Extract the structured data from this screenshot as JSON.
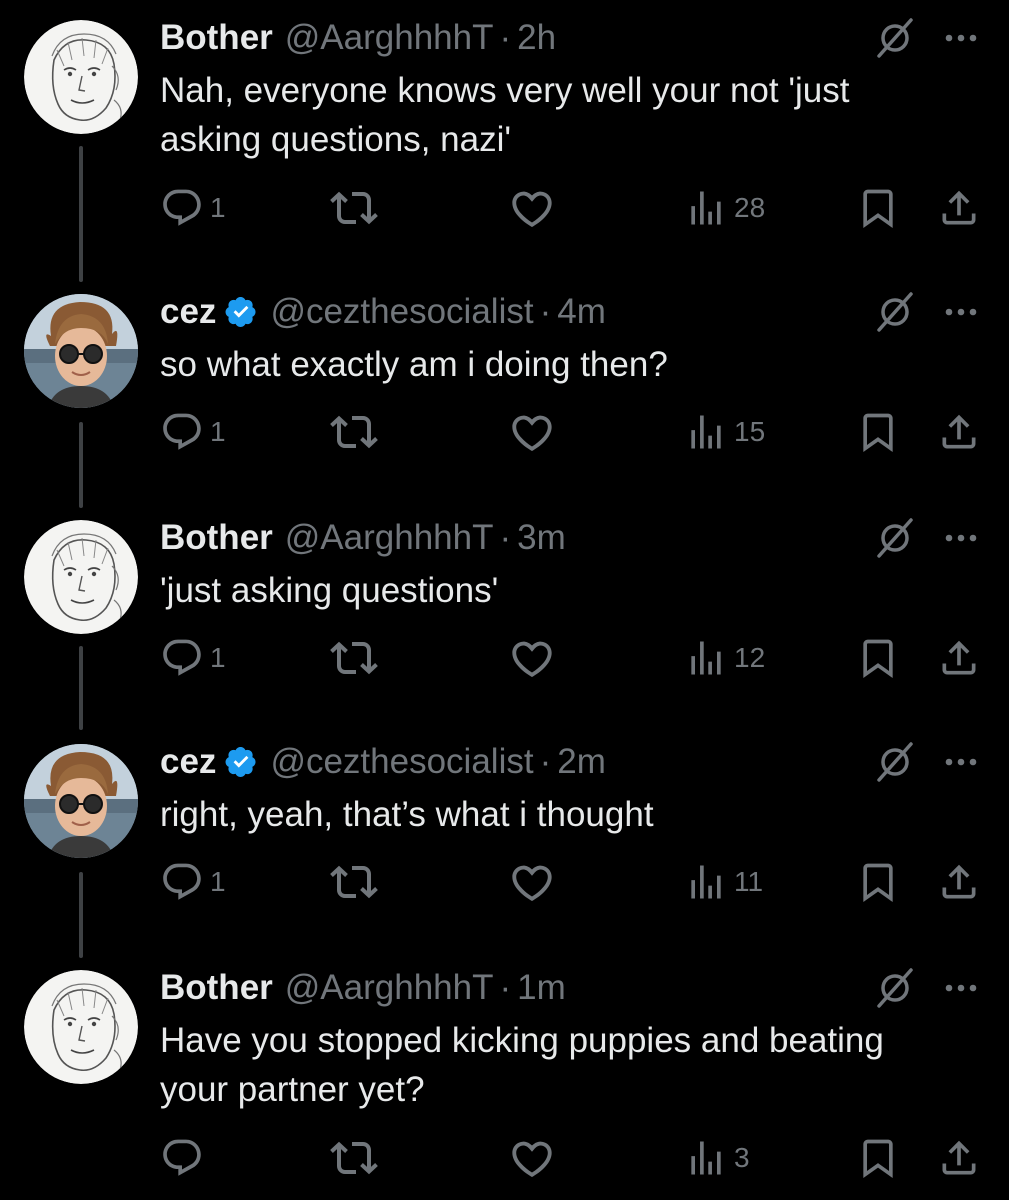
{
  "colors": {
    "background": "#000000",
    "text_primary": "#e7e9ea",
    "text_secondary": "#71767b",
    "thread_line": "#3e4144",
    "verified_blue": "#1d9bf0"
  },
  "icons": {
    "reply": "reply-icon",
    "retweet": "retweet-icon",
    "like": "heart-icon",
    "views": "views-icon",
    "bookmark": "bookmark-icon",
    "share": "share-icon",
    "grok": "grok-icon",
    "more": "more-icon",
    "verified": "verified-badge-icon"
  },
  "tweets": [
    {
      "author": "Bother",
      "handle": "@AarghhhhT",
      "separator": "·",
      "time": "2h",
      "verified": false,
      "avatar": "sketch-portrait-avatar",
      "text": "Nah, everyone knows very well your not 'just asking questions, nazi'",
      "replies": "1",
      "views": "28"
    },
    {
      "author": "cez",
      "handle": "@cezthesocialist",
      "separator": "·",
      "time": "4m",
      "verified": true,
      "avatar": "photo-avatar",
      "text": "so what exactly am i doing then?",
      "replies": "1",
      "views": "15"
    },
    {
      "author": "Bother",
      "handle": "@AarghhhhT",
      "separator": "·",
      "time": "3m",
      "verified": false,
      "avatar": "sketch-portrait-avatar",
      "text": "'just asking questions'",
      "replies": "1",
      "views": "12"
    },
    {
      "author": "cez",
      "handle": "@cezthesocialist",
      "separator": "·",
      "time": "2m",
      "verified": true,
      "avatar": "photo-avatar",
      "text": "right, yeah, that’s what i thought",
      "replies": "1",
      "views": "11"
    },
    {
      "author": "Bother",
      "handle": "@AarghhhhT",
      "separator": "·",
      "time": "1m",
      "verified": false,
      "avatar": "sketch-portrait-avatar",
      "text": "Have you stopped kicking puppies and beating your partner yet?",
      "replies": "",
      "views": "3"
    }
  ]
}
